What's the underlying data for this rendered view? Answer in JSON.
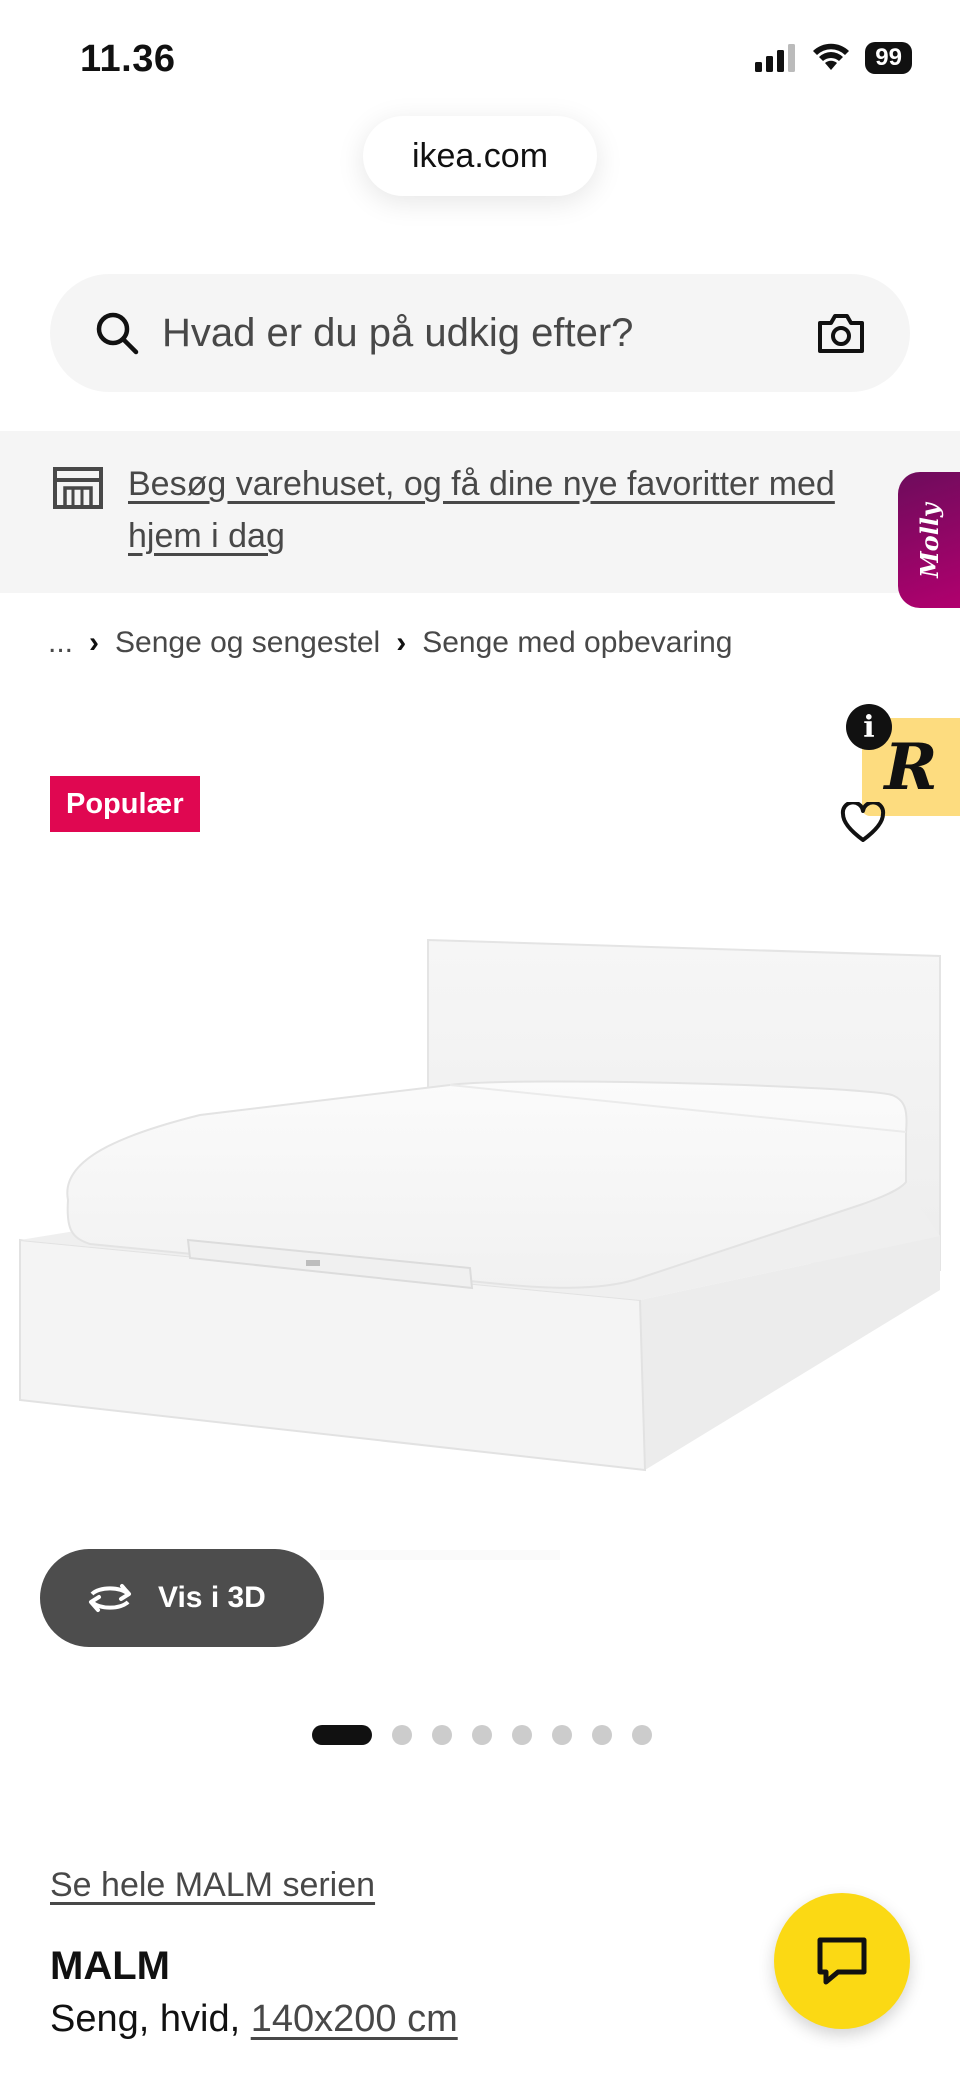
{
  "status_bar": {
    "time": "11.36",
    "battery": "99"
  },
  "browser": {
    "url": "ikea.com"
  },
  "search": {
    "placeholder": "Hvad er du på udkig efter?"
  },
  "banner": {
    "text": "Besøg varehuset, og få dine nye favoritter med hjem i dag"
  },
  "side_tab": {
    "label": "Molly"
  },
  "breadcrumb": {
    "ellipsis": "...",
    "items": [
      "Senge og sengestel",
      "Senge med opbevaring"
    ]
  },
  "product": {
    "badge": "Populær",
    "view_3d_label": "Vis i 3D",
    "image_count": 8,
    "active_image": 1,
    "series_link": "Se hele MALM serien",
    "name": "MALM",
    "description": "Seng, hvid,",
    "size": "140x200 cm"
  },
  "rakuten": {
    "letter": "R",
    "info": "i"
  },
  "colors": {
    "badge": "#e00751",
    "chat": "#fbd914",
    "view3d": "#4d4d4d",
    "banner_bg": "#f5f5f5"
  }
}
